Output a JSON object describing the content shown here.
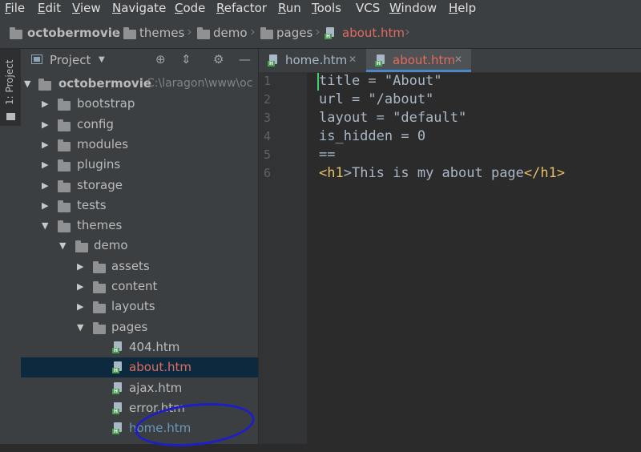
{
  "menu": [
    {
      "label": "File",
      "mn": "F",
      "rest": "ile"
    },
    {
      "label": "Edit",
      "mn": "E",
      "rest": "dit"
    },
    {
      "label": "View",
      "mn": "V",
      "rest": "iew"
    },
    {
      "label": "Navigate",
      "mn": "N",
      "rest": "avigate"
    },
    {
      "label": "Code",
      "mn": "C",
      "rest": "ode"
    },
    {
      "label": "Refactor",
      "mn": "R",
      "rest": "efactor"
    },
    {
      "label": "Run",
      "mn": "R",
      "rest": "un"
    },
    {
      "label": "Tools",
      "mn": "T",
      "rest": "ools"
    },
    {
      "label": "VCS",
      "mn": "",
      "rest": "VCS"
    },
    {
      "label": "Window",
      "mn": "W",
      "rest": "indow"
    },
    {
      "label": "Help",
      "mn": "H",
      "rest": "elp"
    }
  ],
  "breadcrumb": [
    "octobermovie",
    "themes",
    "demo",
    "pages",
    "about.htm"
  ],
  "sidebar_tab": "1: Project",
  "panel": {
    "title": "Project",
    "dropdown_icon": "caret-down-icon",
    "buttons": [
      "locate-icon",
      "collapse-icon",
      "gear-icon",
      "minimize-icon"
    ]
  },
  "tree": [
    {
      "label": "octobermovie",
      "path": "C:\\laragon\\www\\oc",
      "indent": 0,
      "type": "folder",
      "arrow": "▼"
    },
    {
      "label": "bootstrap",
      "indent": 1,
      "type": "folder",
      "arrow": "▶"
    },
    {
      "label": "config",
      "indent": 1,
      "type": "folder",
      "arrow": "▶"
    },
    {
      "label": "modules",
      "indent": 1,
      "type": "folder",
      "arrow": "▶"
    },
    {
      "label": "plugins",
      "indent": 1,
      "type": "folder",
      "arrow": "▶"
    },
    {
      "label": "storage",
      "indent": 1,
      "type": "folder",
      "arrow": "▶"
    },
    {
      "label": "tests",
      "indent": 1,
      "type": "folder",
      "arrow": "▶"
    },
    {
      "label": "themes",
      "indent": 1,
      "type": "folder",
      "arrow": "▼"
    },
    {
      "label": "demo",
      "indent": 2,
      "type": "folder",
      "arrow": "▼"
    },
    {
      "label": "assets",
      "indent": 3,
      "type": "folder",
      "arrow": "▶"
    },
    {
      "label": "content",
      "indent": 3,
      "type": "folder",
      "arrow": "▶"
    },
    {
      "label": "layouts",
      "indent": 3,
      "type": "folder",
      "arrow": "▶"
    },
    {
      "label": "pages",
      "indent": 3,
      "type": "folder",
      "arrow": "▼"
    },
    {
      "label": "404.htm",
      "indent": 4,
      "type": "file"
    },
    {
      "label": "about.htm",
      "indent": 4,
      "type": "file",
      "selected": true,
      "color": "red"
    },
    {
      "label": "ajax.htm",
      "indent": 4,
      "type": "file"
    },
    {
      "label": "error.htm",
      "indent": 4,
      "type": "file"
    },
    {
      "label": "home.htm",
      "indent": 4,
      "type": "file",
      "color": "blue"
    }
  ],
  "tabs": [
    {
      "label": "home.htm",
      "active": false
    },
    {
      "label": "about.htm",
      "active": true
    }
  ],
  "code": [
    {
      "n": "1",
      "text": "title = \"About\""
    },
    {
      "n": "2",
      "text": "url = \"/about\""
    },
    {
      "n": "3",
      "text": "layout = \"default\""
    },
    {
      "n": "4",
      "text": "is_hidden = 0"
    },
    {
      "n": "5",
      "text": "=="
    },
    {
      "n": "6",
      "pre": "<",
      "tag1": "h1",
      "mid": ">This is my about page</",
      "tag2": "h1",
      "post": ">"
    }
  ],
  "colors": {
    "accent": "#4a88c7",
    "selected_file": "#e06c5c",
    "modified_file": "#6897bb",
    "annotation": "#1d1ec8"
  }
}
